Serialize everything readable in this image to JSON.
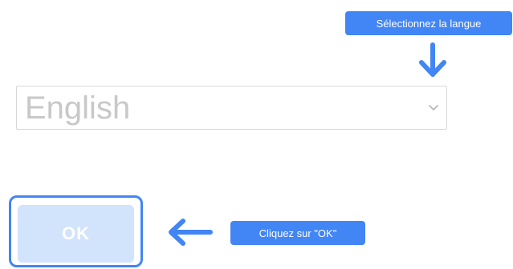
{
  "callouts": {
    "select_language": "Sélectionnez la langue",
    "click_ok": "Cliquez sur \"OK\""
  },
  "language_select": {
    "value": "English",
    "icon": "chevron-down-icon"
  },
  "ok_button": {
    "label": "OK"
  },
  "colors": {
    "accent": "#4285f4",
    "button_disabled_bg": "#d2e3fc",
    "select_text": "#c8c8c8",
    "select_border": "#d8d8d8"
  },
  "icons": {
    "down_arrow": "arrow-down-icon",
    "left_arrow": "arrow-left-icon"
  }
}
